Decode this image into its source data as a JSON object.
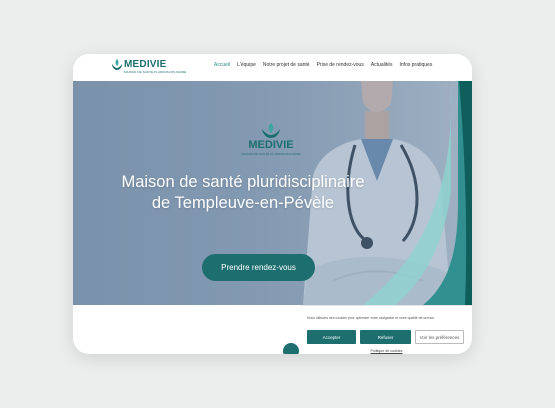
{
  "brand": {
    "name": "MEDIVIE",
    "tagline": "MAISON DE SANTÉ PLURIDISCIPLINAIRE"
  },
  "nav": {
    "items": [
      "Accueil",
      "L'équipe",
      "Notre projet de santé",
      "Prise de rendez-vous",
      "Actualités",
      "Infos pratiques"
    ],
    "active_index": 0
  },
  "hero": {
    "title_line1": "Maison de santé pluridisciplinaire",
    "title_line2": "de Templeuve-en-Pévèle",
    "cta": "Prendre rendez-vous"
  },
  "cookie_banner": {
    "text": "Nous utilisons des cookies pour optimiser votre navigation et notre qualité de service.",
    "accept": "Accepter",
    "refuse": "Refuser",
    "preferences": "Voir les préférences",
    "policy_link": "Politique de cookies"
  },
  "colors": {
    "primary": "#1d6e6e",
    "accent": "#2a8b8b",
    "light_teal": "#8fd3cf"
  }
}
